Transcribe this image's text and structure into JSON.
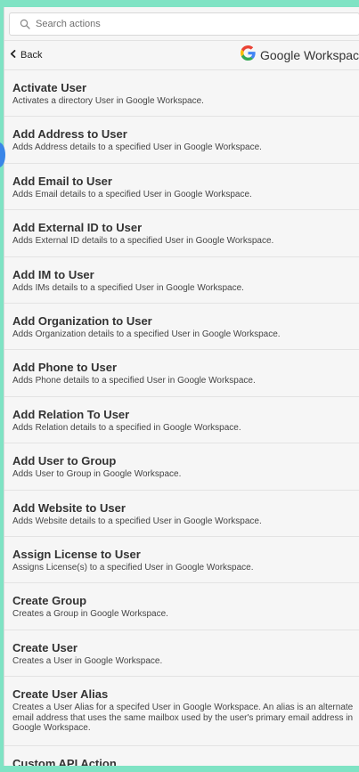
{
  "search": {
    "placeholder": "Search actions",
    "icon": "search-icon"
  },
  "nav": {
    "back_label": "Back",
    "back_icon": "chevron-left-icon",
    "brand_icon": "google-g-icon",
    "brand_name": "Google Workspace",
    "brand_colors": [
      "#4285F4",
      "#EA4335",
      "#FBBC05",
      "#34A853"
    ]
  },
  "actions": [
    {
      "title": "Activate User",
      "description": "Activates a directory User in Google Workspace."
    },
    {
      "title": "Add Address to User",
      "description": "Adds Address details to a specified User in Google Workspace."
    },
    {
      "title": "Add Email to User",
      "description": "Adds Email details to a specified User in Google Workspace."
    },
    {
      "title": "Add External ID to User",
      "description": "Adds External ID details to a specified User in Google Workspace."
    },
    {
      "title": "Add IM to User",
      "description": "Adds IMs details to a specified User in Google Workspace."
    },
    {
      "title": "Add Organization to User",
      "description": "Adds Organization details to a specified User in Google Workspace."
    },
    {
      "title": "Add Phone to User",
      "description": "Adds Phone details to a specified User in Google Workspace."
    },
    {
      "title": "Add Relation To User",
      "description": "Adds Relation details to a specified in Google Workspace."
    },
    {
      "title": "Add User to Group",
      "description": "Adds User to Group in Google Workspace."
    },
    {
      "title": "Add Website to User",
      "description": "Adds Website details to a specified User in Google Workspace."
    },
    {
      "title": "Assign License to User",
      "description": "Assigns License(s) to a specified User in Google Workspace."
    },
    {
      "title": "Create Group",
      "description": "Creates a Group in Google Workspace."
    },
    {
      "title": "Create User",
      "description": "Creates a User in Google Workspace."
    },
    {
      "title": "Create User Alias",
      "description": "Creates a User Alias for a specifed User in Google Workspace. An alias is an alternate email address that uses the same mailbox used by the user's primary email address in Google Workspace."
    },
    {
      "title": "Custom API Action",
      "description": ""
    }
  ],
  "colors": {
    "background": "#7fe3c4",
    "panel": "#f6f6f6",
    "side_marker": "#3a86e8"
  }
}
